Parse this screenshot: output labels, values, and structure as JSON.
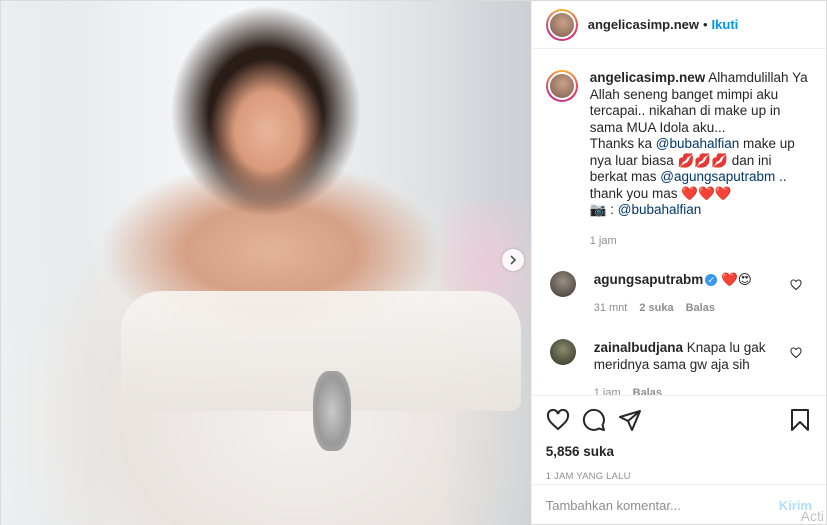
{
  "header": {
    "username": "angelicasimp.new",
    "separator": "•",
    "follow_label": "Ikuti"
  },
  "caption": {
    "username": "angelicasimp.new",
    "text_1": " Alhamdulillah Ya Allah seneng banget mimpi aku tercapai.. nikahan di make up in sama MUA Idola aku...",
    "text_2": "Thanks ka ",
    "mention_1": "@bubahalfian",
    "text_3": " make up nya luar biasa ",
    "lips": "💋💋💋",
    "text_4": " dan ini berkat mas ",
    "mention_2": "@agungsaputrabm",
    "text_5": " .. thank you mas ",
    "hearts": "❤️❤️❤️",
    "camera": "📷",
    "text_6": " : ",
    "mention_3": "@bubahalfian",
    "time": "1 jam"
  },
  "comments": [
    {
      "username": "agungsaputrabm",
      "verified": "✓",
      "text": " ❤️😍",
      "time": "31 mnt",
      "likes": "2 suka",
      "reply": "Balas"
    },
    {
      "username": "zainalbudjana",
      "text": " Knapa lu gak meridnya sama gw aja sih",
      "time": "1 jam",
      "reply": "Balas"
    }
  ],
  "post": {
    "likes": "5,856 suka",
    "ago": "1 JAM YANG LALU"
  },
  "add_comment": {
    "placeholder": "Tambahkan komentar...",
    "post_label": "Kirim"
  },
  "watermark": "Acti",
  "icons": [
    "heart-icon",
    "comment-icon",
    "share-icon",
    "bookmark-icon",
    "chevron-right-icon"
  ]
}
